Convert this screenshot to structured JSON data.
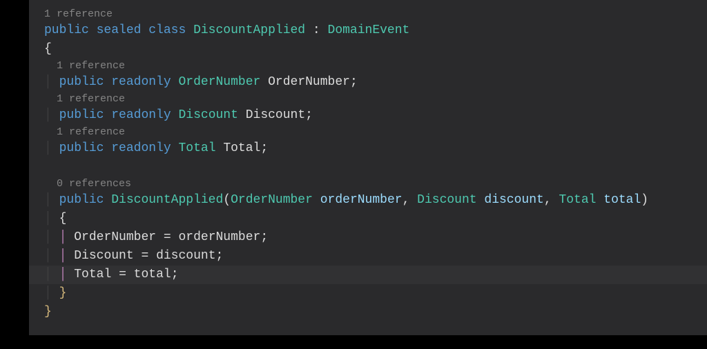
{
  "codelens": {
    "classRef": "1 reference",
    "field1Ref": "1 reference",
    "field2Ref": "1 reference",
    "field3Ref": "1 reference",
    "ctorRef": "0 references"
  },
  "tokens": {
    "publicKw": "public",
    "sealedKw": "sealed",
    "classKw": "class",
    "readonlyKw": "readonly",
    "className": "DiscountApplied",
    "baseClass": "DomainEvent",
    "colon": " : ",
    "openBrace": "{",
    "closeBrace": "}",
    "semicolon": ";",
    "comma": ", ",
    "equals": " = ",
    "lparen": "(",
    "rparen": ")",
    "field1Type": "OrderNumber",
    "field1Name": "OrderNumber",
    "field2Type": "Discount",
    "field2Name": "Discount",
    "field3Type": "Total",
    "field3Name": "Total",
    "ctorName": "DiscountApplied",
    "p1Type": "OrderNumber",
    "p1Name": "orderNumber",
    "p2Type": "Discount",
    "p2Name": "discount",
    "p3Type": "Total",
    "p3Name": "total",
    "assign1L": "OrderNumber",
    "assign1R": "orderNumber",
    "assign2L": "Discount",
    "assign2R": "discount",
    "assign3L": "Total",
    "assign3R": "total",
    "guide": "│"
  }
}
